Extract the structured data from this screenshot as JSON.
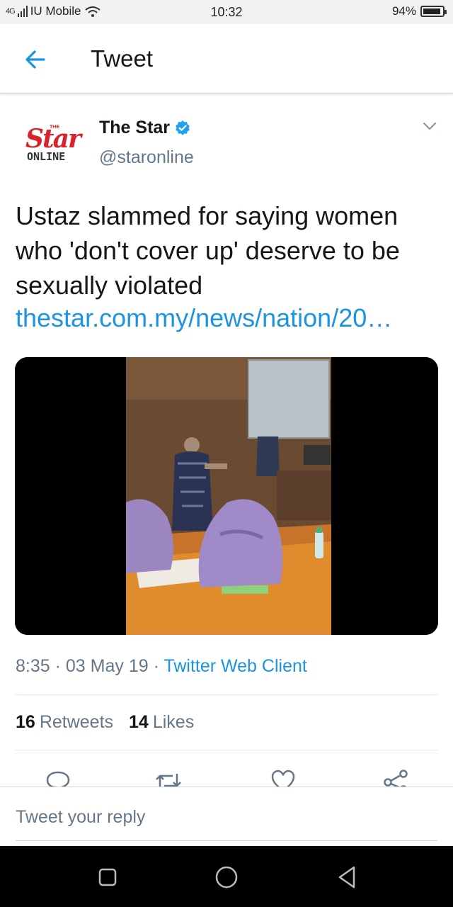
{
  "status_bar": {
    "network": "4G",
    "carrier": "IU Mobile",
    "time": "10:32",
    "battery": "94%",
    "battery_level": 0.94
  },
  "header": {
    "title": "Tweet",
    "back_icon": "arrow-left-icon"
  },
  "tweet": {
    "avatar_text_the": "THE",
    "avatar_text_star": "Star",
    "avatar_text_online": "ONLINE",
    "author_name": "The Star",
    "author_handle": "@staronline",
    "verified_icon": "verified-badge-icon",
    "text": "Ustaz slammed for saying women who 'don't cover up' deserve to be sexually violated",
    "link": "thestar.com.my/news/nation/20…",
    "time": "8:35",
    "date": "03 May 19",
    "source": "Twitter Web Client",
    "retweets_count": "16",
    "retweets_label": "Retweets",
    "likes_count": "14",
    "likes_label": "Likes"
  },
  "actions": [
    "reply-icon",
    "retweet-icon",
    "like-icon",
    "share-icon"
  ],
  "reply_bar": {
    "placeholder": "Tweet your reply"
  },
  "nav_bar": [
    "recents-square-icon",
    "home-circle-icon",
    "back-triangle-icon"
  ],
  "colors": {
    "link": "#1b95e0",
    "secondary_text": "#657786",
    "verified": "#1da1f2",
    "brand_red": "#d8232a"
  }
}
